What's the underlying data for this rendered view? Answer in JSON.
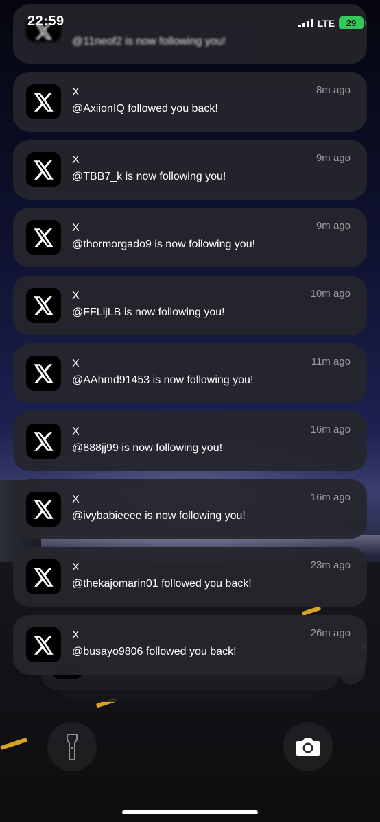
{
  "status_bar": {
    "time": "22:59",
    "network": "LTE",
    "battery": "29"
  },
  "notifications": [
    {
      "app": "X",
      "time": "",
      "message": "@11neof2 is now following you!"
    },
    {
      "app": "X",
      "time": "8m ago",
      "message": "@AxiionIQ followed you back!"
    },
    {
      "app": "X",
      "time": "9m ago",
      "message": "@TBB7_k is now following you!"
    },
    {
      "app": "X",
      "time": "9m ago",
      "message": "@thormorgado9 is now following you!"
    },
    {
      "app": "X",
      "time": "10m ago",
      "message": "@FFLijLB is now following you!"
    },
    {
      "app": "X",
      "time": "11m ago",
      "message": "@AAhmd91453 is now following you!"
    },
    {
      "app": "X",
      "time": "16m ago",
      "message": "@888jj99 is now following you!"
    },
    {
      "app": "X",
      "time": "16m ago",
      "message": "@ivybabieeee is now following you!"
    },
    {
      "app": "X",
      "time": "23m ago",
      "message": "@thekajomarin01 followed you back!"
    },
    {
      "app": "X",
      "time": "26m ago",
      "message": "@busayo9806 followed you back!"
    }
  ],
  "stack_count_peek": "8",
  "icons": {
    "app": "x-logo-icon",
    "flashlight": "flashlight-icon",
    "camera": "camera-icon"
  }
}
